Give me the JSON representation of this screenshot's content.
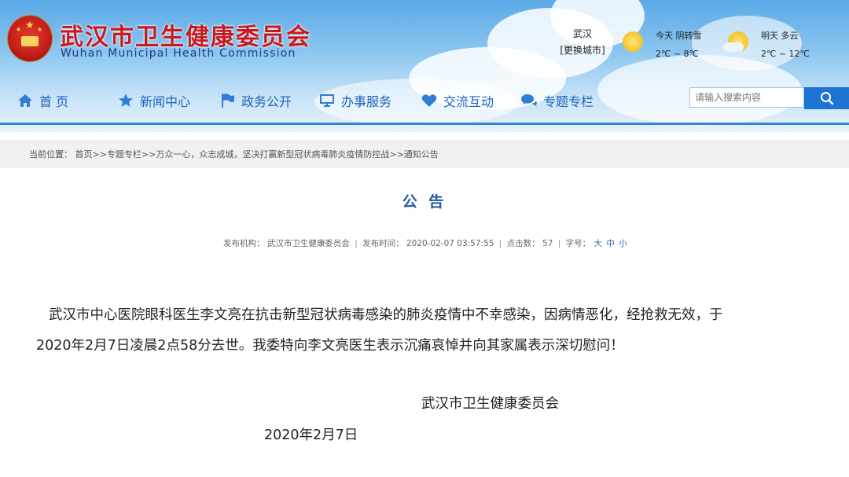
{
  "header": {
    "title": "武汉市卫生健康委员会",
    "subtitle": "Wuhan Municipal Health Commission",
    "logo_icon": "national-emblem-icon"
  },
  "weather": {
    "city": "武汉",
    "change_city": "[更换城市]",
    "today": {
      "label": "今天 阴转雪",
      "temp": "2℃ ~ 8℃",
      "icon": "sun-snow-icon"
    },
    "tomorrow": {
      "label": "明天 多云",
      "temp": "2℃ ~ 12℃",
      "icon": "sun-cloud-icon"
    }
  },
  "nav": {
    "items": [
      {
        "label": "首 页",
        "icon": "home-icon"
      },
      {
        "label": "新闻中心",
        "icon": "star-icon"
      },
      {
        "label": "政务公开",
        "icon": "flag-icon"
      },
      {
        "label": "办事服务",
        "icon": "monitor-icon"
      },
      {
        "label": "交流互动",
        "icon": "heart-icon"
      },
      {
        "label": "专题专栏",
        "icon": "chat-icon"
      }
    ],
    "search_placeholder": "请输入搜索内容"
  },
  "breadcrumb": "当前位置： 首页>>专题专栏>>万众一心，众志成城，坚决打赢新型冠状病毒肺炎疫情防控战>>通知公告",
  "article": {
    "title": "公 告",
    "meta": {
      "org_label": "发布机构：",
      "org": "武汉市卫生健康委员会",
      "time_label": "发布时间：",
      "time": "2020-02-07 03:57:55",
      "clicks_label": "点击数：",
      "clicks": "57",
      "fontsize_label": "字号：",
      "size_large": "大",
      "size_medium": "中",
      "size_small": "小"
    },
    "body_line1": "武汉市中心医院眼科医生李文亮在抗击新型冠状病毒感染的肺炎疫情中不幸感染，因病情恶化，经抢救无效，于",
    "body_line2": "2020年2月7日凌晨2点58分去世。我委特向李文亮医生表示沉痛哀悼并向其家属表示深切慰问！",
    "signature_org": "武汉市卫生健康委员会",
    "signature_date": "2020年2月7日"
  },
  "colors": {
    "title_red": "#c7191f",
    "nav_blue": "#1d63b8",
    "accent_blue": "#1d74d4"
  }
}
